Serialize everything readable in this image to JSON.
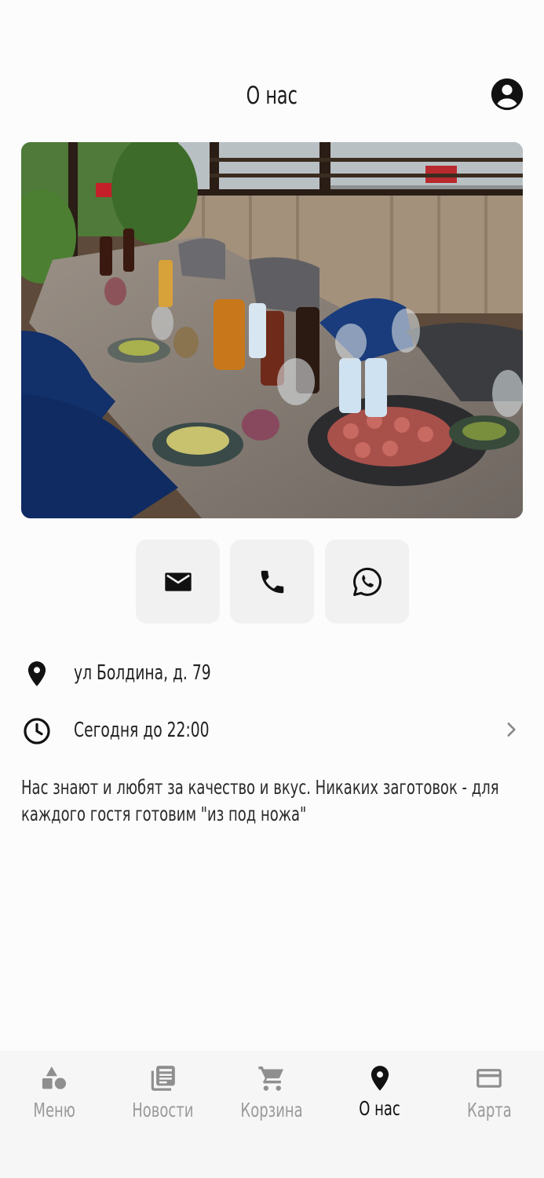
{
  "header": {
    "title": "О нас",
    "profile_icon": "account-circle-icon"
  },
  "hero": {
    "alt": "restaurant-table-photo"
  },
  "contacts": [
    {
      "icon": "mail-icon"
    },
    {
      "icon": "phone-icon"
    },
    {
      "icon": "whatsapp-icon"
    }
  ],
  "address": {
    "icon": "location-pin-icon",
    "text": "ул Болдина, д. 79"
  },
  "hours": {
    "icon": "clock-icon",
    "text": "Сегодня до 22:00",
    "chevron": "chevron-right-icon"
  },
  "description": "Нас знают и любят за качество и вкус. Никаких заготовок - для каждого гостя готовим \"из под ножа\"",
  "tabbar": {
    "active_color": "#111111",
    "inactive_color": "#9a9a9a",
    "items": [
      {
        "label": "Меню",
        "icon": "shapes-icon",
        "active": false
      },
      {
        "label": "Новости",
        "icon": "newspaper-icon",
        "active": false
      },
      {
        "label": "Корзина",
        "icon": "cart-icon",
        "active": false
      },
      {
        "label": "О нас",
        "icon": "location-pin-icon",
        "active": true
      },
      {
        "label": "Карта",
        "icon": "credit-card-icon",
        "active": false
      }
    ]
  }
}
